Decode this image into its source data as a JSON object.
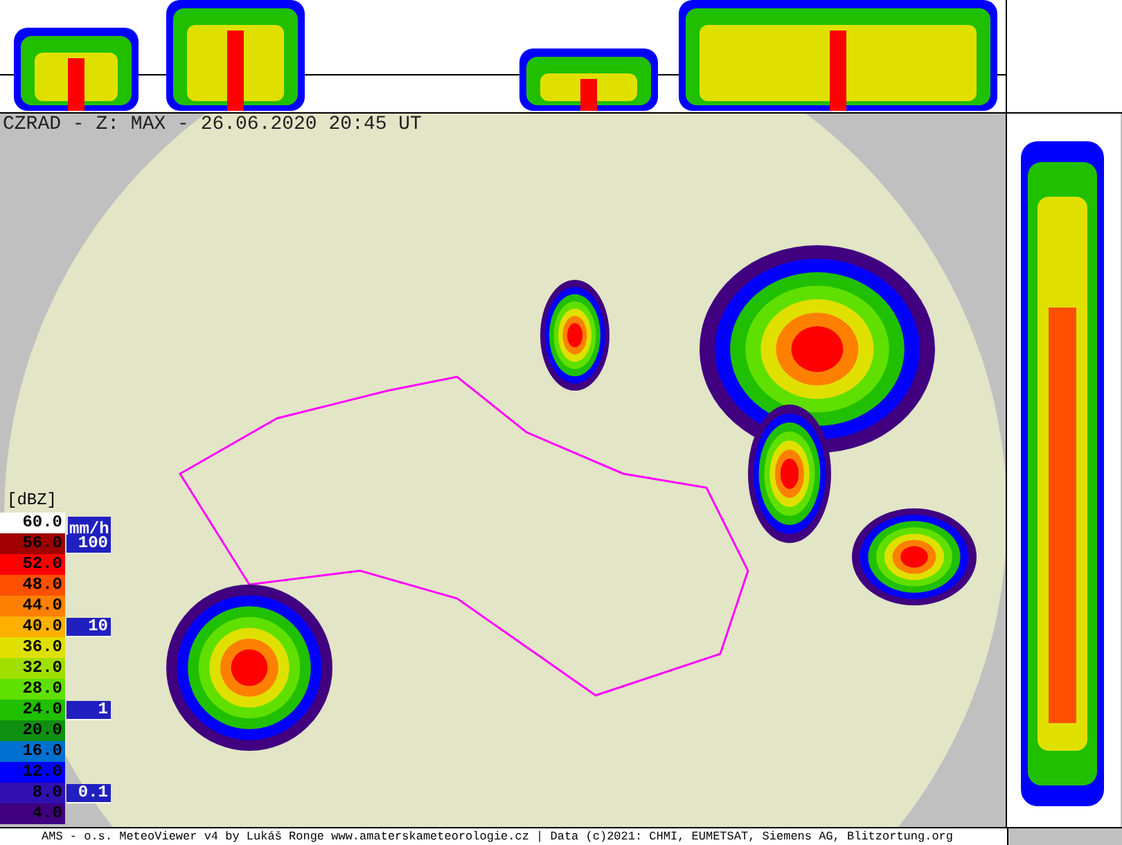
{
  "title": "CZRAD - Z: MAX - 26.06.2020 20:45 UT",
  "legend": {
    "unit": "[dBZ]",
    "levels": [
      {
        "label": "60.0",
        "color": "#ffffff"
      },
      {
        "label": "56.0",
        "color": "#a00000"
      },
      {
        "label": "52.0",
        "color": "#ff0000"
      },
      {
        "label": "48.0",
        "color": "#ff5000"
      },
      {
        "label": "44.0",
        "color": "#ff8000"
      },
      {
        "label": "40.0",
        "color": "#ffb000"
      },
      {
        "label": "36.0",
        "color": "#e0e000"
      },
      {
        "label": "32.0",
        "color": "#a0e000"
      },
      {
        "label": "28.0",
        "color": "#60e000"
      },
      {
        "label": "24.0",
        "color": "#20c000"
      },
      {
        "label": "20.0",
        "color": "#109010"
      },
      {
        "label": "16.0",
        "color": "#0070d0"
      },
      {
        "label": "12.0",
        "color": "#0000ff"
      },
      {
        "label": "8.0",
        "color": "#3010b0"
      },
      {
        "label": "4.0",
        "color": "#400080"
      }
    ]
  },
  "rain_scale": {
    "unit": "mm/h",
    "marks": [
      "100",
      "10",
      "1",
      "0.1"
    ]
  },
  "status_bar": {
    "text": "AMS - o.s. MeteoViewer v4 by Lukáš Ronge www.amaterskameteorologie.cz | Data (c)2021: CHMI, EUMETSAT, Siemens AG, Blitzortung.org"
  }
}
